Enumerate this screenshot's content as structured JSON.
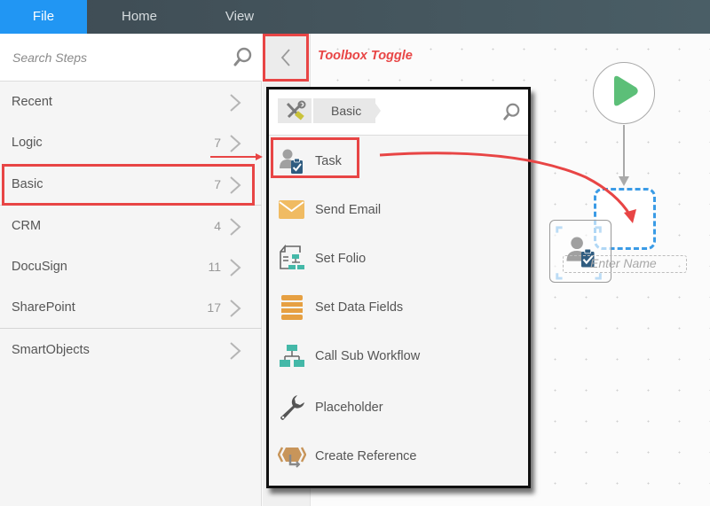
{
  "menu": {
    "tabs": [
      {
        "label": "File",
        "active": true
      },
      {
        "label": "Home",
        "active": false
      },
      {
        "label": "View",
        "active": false
      }
    ],
    "active_color": "#2196f3"
  },
  "sidebar": {
    "search_placeholder": "Search Steps",
    "categories": [
      {
        "label": "Recent",
        "count": ""
      },
      {
        "label": "Logic",
        "count": "7"
      },
      {
        "label": "Basic",
        "count": "7",
        "highlighted": true
      },
      {
        "label": "CRM",
        "count": "4"
      },
      {
        "label": "DocuSign",
        "count": "11"
      },
      {
        "label": "SharePoint",
        "count": "17"
      },
      {
        "label": "SmartObjects",
        "count": ""
      }
    ]
  },
  "toolbox": {
    "toggle_annotation": "Toolbox Toggle",
    "breadcrumb": "Basic",
    "root_icon": "tools-icon",
    "steps": [
      {
        "label": "Task",
        "icon": "task-icon",
        "highlighted": true
      },
      {
        "label": "Send Email",
        "icon": "email-icon"
      },
      {
        "label": "Set Folio",
        "icon": "set-folio-icon"
      },
      {
        "label": "Set Data Fields",
        "icon": "data-fields-icon"
      },
      {
        "label": "Call Sub Workflow",
        "icon": "sub-workflow-icon"
      },
      {
        "label": "Placeholder",
        "icon": "wrench-icon"
      },
      {
        "label": "Create Reference",
        "icon": "create-reference-icon"
      }
    ]
  },
  "canvas": {
    "start_node_color": "#5cbf78",
    "drop_zone_color": "#3a9be6",
    "name_placeholder": "Enter Name"
  },
  "annotation_color": "#e84545"
}
